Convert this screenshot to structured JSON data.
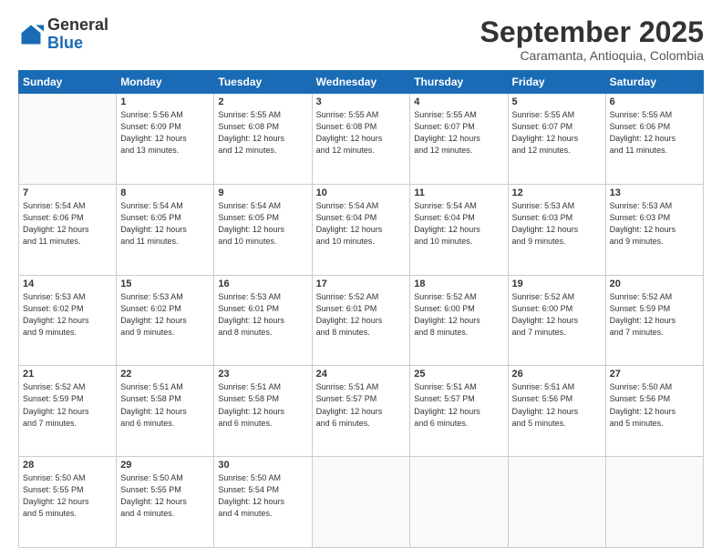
{
  "logo": {
    "general": "General",
    "blue": "Blue"
  },
  "header": {
    "title": "September 2025",
    "subtitle": "Caramanta, Antioquia, Colombia"
  },
  "weekdays": [
    "Sunday",
    "Monday",
    "Tuesday",
    "Wednesday",
    "Thursday",
    "Friday",
    "Saturday"
  ],
  "weeks": [
    [
      {
        "day": "",
        "sunrise": "",
        "sunset": "",
        "daylight": ""
      },
      {
        "day": "1",
        "sunrise": "Sunrise: 5:56 AM",
        "sunset": "Sunset: 6:09 PM",
        "daylight": "Daylight: 12 hours and 13 minutes."
      },
      {
        "day": "2",
        "sunrise": "Sunrise: 5:55 AM",
        "sunset": "Sunset: 6:08 PM",
        "daylight": "Daylight: 12 hours and 12 minutes."
      },
      {
        "day": "3",
        "sunrise": "Sunrise: 5:55 AM",
        "sunset": "Sunset: 6:08 PM",
        "daylight": "Daylight: 12 hours and 12 minutes."
      },
      {
        "day": "4",
        "sunrise": "Sunrise: 5:55 AM",
        "sunset": "Sunset: 6:07 PM",
        "daylight": "Daylight: 12 hours and 12 minutes."
      },
      {
        "day": "5",
        "sunrise": "Sunrise: 5:55 AM",
        "sunset": "Sunset: 6:07 PM",
        "daylight": "Daylight: 12 hours and 12 minutes."
      },
      {
        "day": "6",
        "sunrise": "Sunrise: 5:55 AM",
        "sunset": "Sunset: 6:06 PM",
        "daylight": "Daylight: 12 hours and 11 minutes."
      }
    ],
    [
      {
        "day": "7",
        "sunrise": "Sunrise: 5:54 AM",
        "sunset": "Sunset: 6:06 PM",
        "daylight": "Daylight: 12 hours and 11 minutes."
      },
      {
        "day": "8",
        "sunrise": "Sunrise: 5:54 AM",
        "sunset": "Sunset: 6:05 PM",
        "daylight": "Daylight: 12 hours and 11 minutes."
      },
      {
        "day": "9",
        "sunrise": "Sunrise: 5:54 AM",
        "sunset": "Sunset: 6:05 PM",
        "daylight": "Daylight: 12 hours and 10 minutes."
      },
      {
        "day": "10",
        "sunrise": "Sunrise: 5:54 AM",
        "sunset": "Sunset: 6:04 PM",
        "daylight": "Daylight: 12 hours and 10 minutes."
      },
      {
        "day": "11",
        "sunrise": "Sunrise: 5:54 AM",
        "sunset": "Sunset: 6:04 PM",
        "daylight": "Daylight: 12 hours and 10 minutes."
      },
      {
        "day": "12",
        "sunrise": "Sunrise: 5:53 AM",
        "sunset": "Sunset: 6:03 PM",
        "daylight": "Daylight: 12 hours and 9 minutes."
      },
      {
        "day": "13",
        "sunrise": "Sunrise: 5:53 AM",
        "sunset": "Sunset: 6:03 PM",
        "daylight": "Daylight: 12 hours and 9 minutes."
      }
    ],
    [
      {
        "day": "14",
        "sunrise": "Sunrise: 5:53 AM",
        "sunset": "Sunset: 6:02 PM",
        "daylight": "Daylight: 12 hours and 9 minutes."
      },
      {
        "day": "15",
        "sunrise": "Sunrise: 5:53 AM",
        "sunset": "Sunset: 6:02 PM",
        "daylight": "Daylight: 12 hours and 9 minutes."
      },
      {
        "day": "16",
        "sunrise": "Sunrise: 5:53 AM",
        "sunset": "Sunset: 6:01 PM",
        "daylight": "Daylight: 12 hours and 8 minutes."
      },
      {
        "day": "17",
        "sunrise": "Sunrise: 5:52 AM",
        "sunset": "Sunset: 6:01 PM",
        "daylight": "Daylight: 12 hours and 8 minutes."
      },
      {
        "day": "18",
        "sunrise": "Sunrise: 5:52 AM",
        "sunset": "Sunset: 6:00 PM",
        "daylight": "Daylight: 12 hours and 8 minutes."
      },
      {
        "day": "19",
        "sunrise": "Sunrise: 5:52 AM",
        "sunset": "Sunset: 6:00 PM",
        "daylight": "Daylight: 12 hours and 7 minutes."
      },
      {
        "day": "20",
        "sunrise": "Sunrise: 5:52 AM",
        "sunset": "Sunset: 5:59 PM",
        "daylight": "Daylight: 12 hours and 7 minutes."
      }
    ],
    [
      {
        "day": "21",
        "sunrise": "Sunrise: 5:52 AM",
        "sunset": "Sunset: 5:59 PM",
        "daylight": "Daylight: 12 hours and 7 minutes."
      },
      {
        "day": "22",
        "sunrise": "Sunrise: 5:51 AM",
        "sunset": "Sunset: 5:58 PM",
        "daylight": "Daylight: 12 hours and 6 minutes."
      },
      {
        "day": "23",
        "sunrise": "Sunrise: 5:51 AM",
        "sunset": "Sunset: 5:58 PM",
        "daylight": "Daylight: 12 hours and 6 minutes."
      },
      {
        "day": "24",
        "sunrise": "Sunrise: 5:51 AM",
        "sunset": "Sunset: 5:57 PM",
        "daylight": "Daylight: 12 hours and 6 minutes."
      },
      {
        "day": "25",
        "sunrise": "Sunrise: 5:51 AM",
        "sunset": "Sunset: 5:57 PM",
        "daylight": "Daylight: 12 hours and 6 minutes."
      },
      {
        "day": "26",
        "sunrise": "Sunrise: 5:51 AM",
        "sunset": "Sunset: 5:56 PM",
        "daylight": "Daylight: 12 hours and 5 minutes."
      },
      {
        "day": "27",
        "sunrise": "Sunrise: 5:50 AM",
        "sunset": "Sunset: 5:56 PM",
        "daylight": "Daylight: 12 hours and 5 minutes."
      }
    ],
    [
      {
        "day": "28",
        "sunrise": "Sunrise: 5:50 AM",
        "sunset": "Sunset: 5:55 PM",
        "daylight": "Daylight: 12 hours and 5 minutes."
      },
      {
        "day": "29",
        "sunrise": "Sunrise: 5:50 AM",
        "sunset": "Sunset: 5:55 PM",
        "daylight": "Daylight: 12 hours and 4 minutes."
      },
      {
        "day": "30",
        "sunrise": "Sunrise: 5:50 AM",
        "sunset": "Sunset: 5:54 PM",
        "daylight": "Daylight: 12 hours and 4 minutes."
      },
      {
        "day": "",
        "sunrise": "",
        "sunset": "",
        "daylight": ""
      },
      {
        "day": "",
        "sunrise": "",
        "sunset": "",
        "daylight": ""
      },
      {
        "day": "",
        "sunrise": "",
        "sunset": "",
        "daylight": ""
      },
      {
        "day": "",
        "sunrise": "",
        "sunset": "",
        "daylight": ""
      }
    ]
  ]
}
